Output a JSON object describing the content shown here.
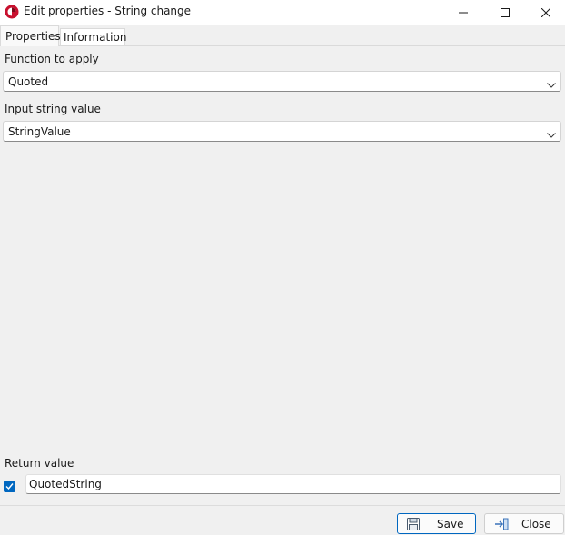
{
  "window": {
    "title": "Edit properties - String change",
    "icons": {
      "app": "app-logo-icon",
      "minimize": "minimize-icon",
      "maximize": "maximize-icon",
      "close": "close-icon"
    }
  },
  "tabs": [
    {
      "label": "Properties",
      "active": true
    },
    {
      "label": "Information",
      "active": false
    }
  ],
  "fields": {
    "function": {
      "label": "Function to apply",
      "value": "Quoted"
    },
    "input": {
      "label": "Input string value",
      "value": "StringValue"
    },
    "return": {
      "label": "Return value",
      "checked": true,
      "value": "QuotedString"
    }
  },
  "buttons": {
    "save": {
      "label": "Save",
      "icon": "floppy-disk-icon"
    },
    "close": {
      "label": "Close",
      "icon": "exit-arrow-icon"
    }
  },
  "colors": {
    "accent": "#0067c0",
    "app_icon_red": "#c8102e",
    "background": "#f0f0f0"
  }
}
